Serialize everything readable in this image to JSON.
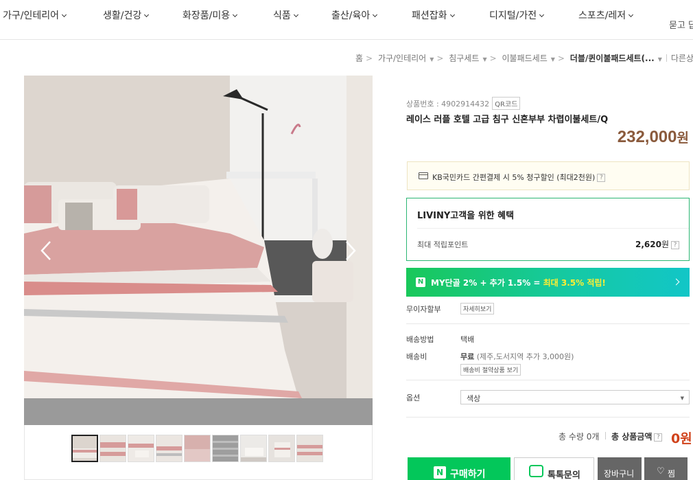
{
  "nav": {
    "categories": [
      "가구/인테리어",
      "생활/건강",
      "화장품/미용",
      "식품",
      "출산/육아",
      "패션잡화",
      "디지털/가전",
      "스포츠/레저"
    ],
    "help": "묻고 답"
  },
  "breadcrumb": {
    "items": [
      "홈",
      "가구/인테리어",
      "침구세트",
      "이불패드세트"
    ],
    "current": "더블/퀸이불패드세트(...",
    "extra": "다른상"
  },
  "product": {
    "number_label": "상품번호 : 4902914432",
    "qr_label": "QR코드",
    "title": "레이스 러플 호텔 고급 침구 신혼부부 차렵이불세트/Q",
    "price": "232,000",
    "currency": "원"
  },
  "card_promo": {
    "text": "KB국민카드 간편결제 시 5% 청구할인 (최대2천원)",
    "help": "?"
  },
  "benefit": {
    "title": "LIVINY고객을 위한 혜택",
    "label": "최대 적립포인트",
    "value": "2,620",
    "unit": "원",
    "help": "?"
  },
  "npay": {
    "logo": "N",
    "text_prefix": "MY단골 2% + 추가 1.5% = ",
    "text_highlight": "최대 3.5% 적립!"
  },
  "installment": {
    "label": "무이자할부",
    "button": "자세히보기"
  },
  "shipping": {
    "method_label": "배송방법",
    "method_value": "택배",
    "fee_label": "배송비",
    "fee_value": "무료",
    "fee_note": "(제주,도서지역 추가 3,000원)",
    "fee_button": "배송비 절약상품 보기"
  },
  "option": {
    "label": "옵션",
    "selected": "색상"
  },
  "total": {
    "qty_label": "총 수량",
    "qty_value": "0개",
    "price_label": "총 상품금액",
    "help": "?",
    "price_value": "0원"
  },
  "actions": {
    "buy_logo": "N",
    "buy": "구매하기",
    "talk": "톡톡문의",
    "cart": "장바구니",
    "wish": "찜"
  },
  "colors": {
    "price": "#8a5a3c",
    "npay_green": "#03c75a",
    "benefit_border": "#2bb673",
    "total_price": "#d0421b"
  },
  "icons": {
    "nav_chevron": "chevron-down-icon",
    "card": "credit-card-icon",
    "image_prev": "chevron-left-icon",
    "image_next": "chevron-right-icon",
    "npay_arrow": "chevron-right-icon",
    "talk": "chat-bubble-icon",
    "wish": "heart-icon"
  }
}
